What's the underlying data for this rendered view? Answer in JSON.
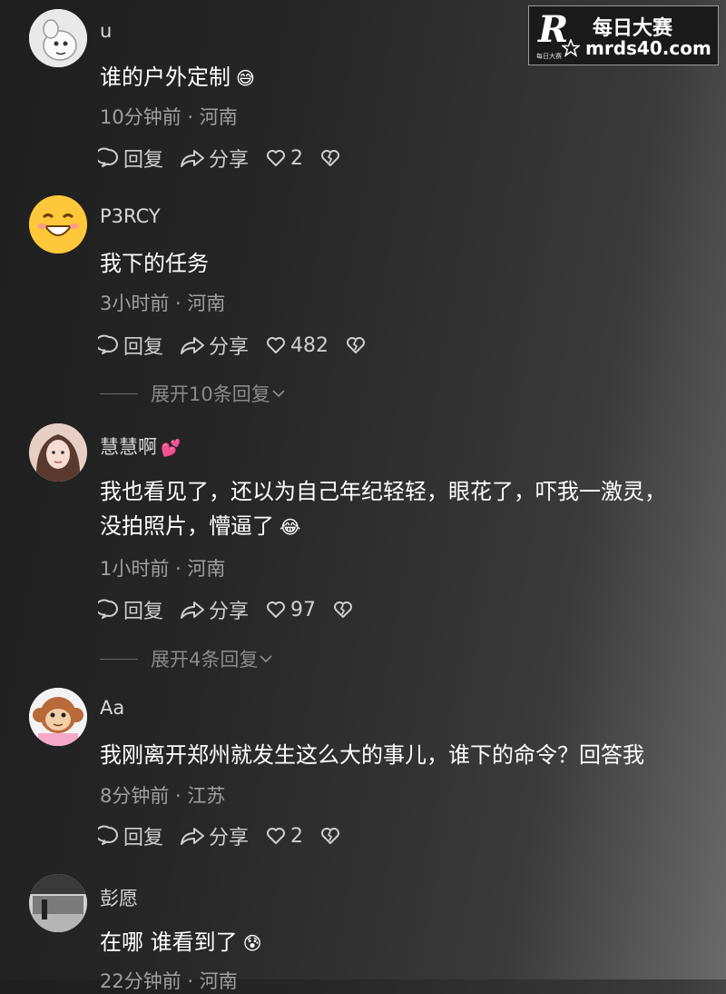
{
  "watermark": {
    "title": "每日大赛",
    "url": "mrds40.com",
    "logo_letter": "R",
    "logo_small": "每日大赛"
  },
  "labels": {
    "reply": "回复",
    "share": "分享"
  },
  "comments": [
    {
      "user": "u",
      "text": "谁的户外定制",
      "emoji": "😅",
      "time_loc": "10分钟前 · 河南",
      "likes": "2"
    },
    {
      "user": "P3RCY",
      "text": "我下的任务",
      "time_loc": "3小时前 · 河南",
      "likes": "482",
      "expand": "展开10条回复"
    },
    {
      "user": "慧慧啊",
      "user_emoji": "💕",
      "text_line1": "我也看见了，还以为自己年纪轻轻，眼花了，吓我一激灵，",
      "text_line2": "没拍照片，懵逼了",
      "emoji": "😂",
      "time_loc": "1小时前 · 河南",
      "likes": "97",
      "expand": "展开4条回复"
    },
    {
      "user": "Aa",
      "text": "我刚离开郑州就发生这么大的事儿，谁下的命令？回答我",
      "time_loc": "8分钟前 · 江苏",
      "likes": "2"
    },
    {
      "user": "彭愿",
      "text": "在哪 谁看到了",
      "emoji": "😰",
      "time_loc": "22分钟前 · 河南"
    }
  ]
}
